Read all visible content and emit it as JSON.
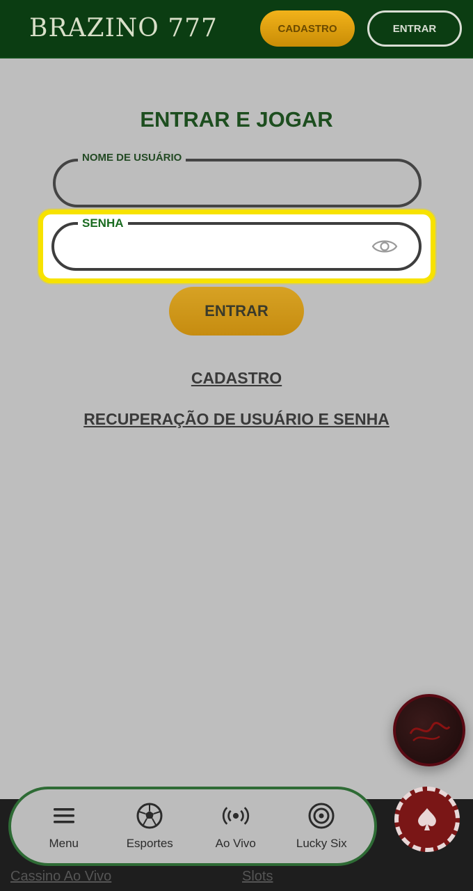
{
  "header": {
    "logo_text": "BRAZINO 777",
    "cadastro_label": "CADASTRO",
    "entrar_label": "ENTRAR"
  },
  "login": {
    "title": "ENTRAR E JOGAR",
    "username_label": "NOME DE USUÁRIO",
    "username_value": "",
    "password_label": "SENHA",
    "password_value": "",
    "submit_label": "ENTRAR",
    "register_link": "CADASTRO",
    "recover_link": "RECUPERAÇÃO DE USUÁRIO E SENHA"
  },
  "promo": {
    "icon": "promo-bubble-icon"
  },
  "bottom_nav": {
    "items": [
      {
        "label": "Menu",
        "icon": "menu-icon"
      },
      {
        "label": "Esportes",
        "icon": "soccer-ball-icon"
      },
      {
        "label": "Ao Vivo",
        "icon": "broadcast-icon"
      },
      {
        "label": "Lucky Six",
        "icon": "lucky-six-icon"
      }
    ],
    "chip_icon": "poker-chip-spade-icon",
    "bottom_links": [
      "Cassino Ao Vivo",
      "Slots"
    ]
  },
  "colors": {
    "header_bg": "#0b3d12",
    "accent_gold": "#e0a312",
    "highlight_yellow": "#f7e200",
    "label_green": "#1a6b20"
  }
}
